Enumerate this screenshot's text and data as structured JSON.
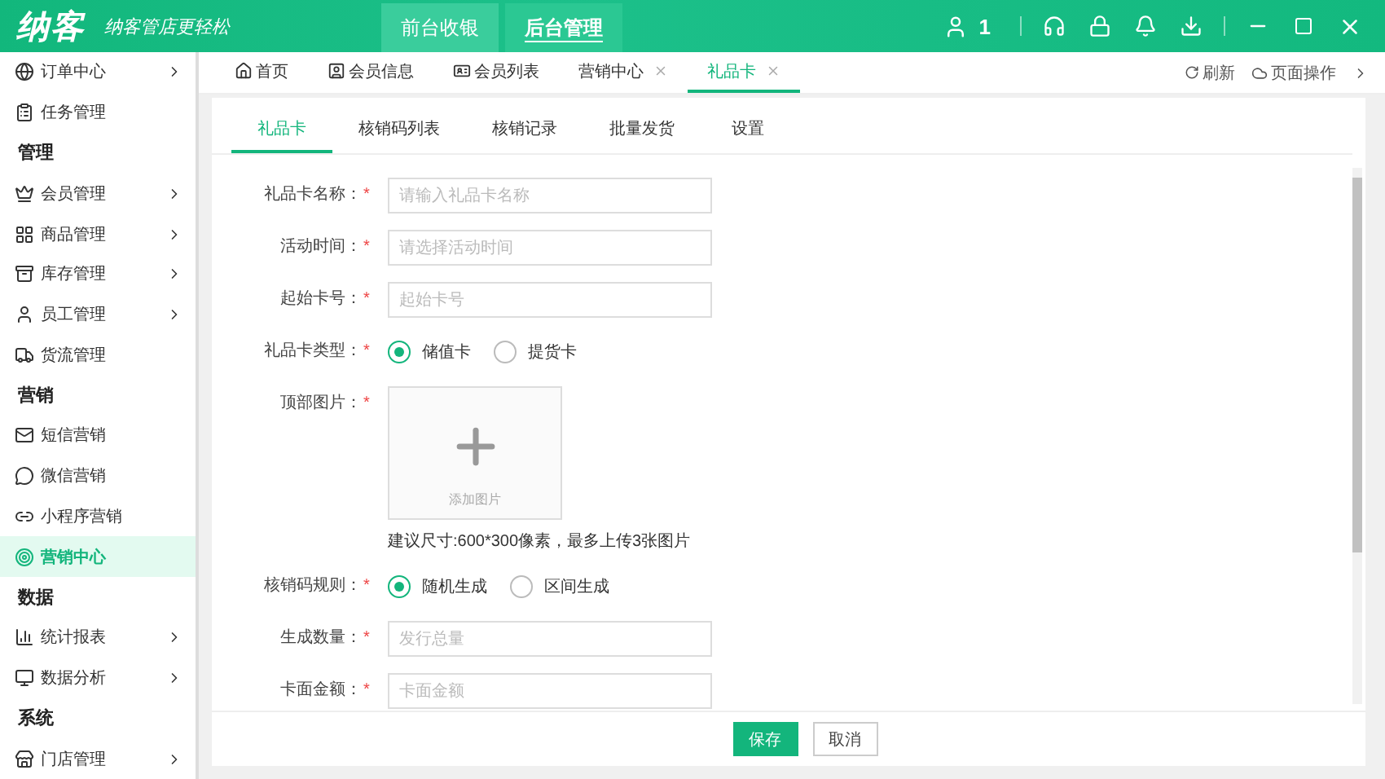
{
  "header": {
    "logo": "纳客",
    "slogan": "纳客管店更轻松",
    "modes": [
      {
        "label": "前台收银",
        "selected": false
      },
      {
        "label": "后台管理",
        "selected": true
      }
    ],
    "user_count": "1"
  },
  "sidebar": {
    "items": [
      {
        "kind": "item",
        "label": "订单中心",
        "arrow": true,
        "selected": false
      },
      {
        "kind": "item",
        "label": "任务管理",
        "arrow": false,
        "selected": false
      },
      {
        "kind": "heading",
        "label": "管理"
      },
      {
        "kind": "item",
        "label": "会员管理",
        "arrow": true,
        "selected": false
      },
      {
        "kind": "item",
        "label": "商品管理",
        "arrow": true,
        "selected": false
      },
      {
        "kind": "item",
        "label": "库存管理",
        "arrow": true,
        "selected": false
      },
      {
        "kind": "item",
        "label": "员工管理",
        "arrow": true,
        "selected": false
      },
      {
        "kind": "item",
        "label": "货流管理",
        "arrow": false,
        "selected": false
      },
      {
        "kind": "heading",
        "label": "营销"
      },
      {
        "kind": "item",
        "label": "短信营销",
        "arrow": false,
        "selected": false
      },
      {
        "kind": "item",
        "label": "微信营销",
        "arrow": false,
        "selected": false
      },
      {
        "kind": "item",
        "label": "小程序营销",
        "arrow": false,
        "selected": false
      },
      {
        "kind": "item",
        "label": "营销中心",
        "arrow": false,
        "selected": true
      },
      {
        "kind": "heading",
        "label": "数据"
      },
      {
        "kind": "item",
        "label": "统计报表",
        "arrow": true,
        "selected": false
      },
      {
        "kind": "item",
        "label": "数据分析",
        "arrow": true,
        "selected": false
      },
      {
        "kind": "heading",
        "label": "系统"
      },
      {
        "kind": "item",
        "label": "门店管理",
        "arrow": true,
        "selected": false
      }
    ]
  },
  "page_tabs": [
    {
      "label": "首页",
      "closable": false,
      "selected": false
    },
    {
      "label": "会员信息",
      "closable": false,
      "selected": false
    },
    {
      "label": "会员列表",
      "closable": false,
      "selected": false
    },
    {
      "label": "营销中心",
      "closable": true,
      "selected": false
    },
    {
      "label": "礼品卡",
      "closable": true,
      "selected": true
    }
  ],
  "page_actions": [
    "刷新",
    "页面操作"
  ],
  "sub_tabs": [
    {
      "label": "礼品卡",
      "selected": true
    },
    {
      "label": "核销码列表",
      "selected": false
    },
    {
      "label": "核销记录",
      "selected": false
    },
    {
      "label": "批量发货",
      "selected": false
    },
    {
      "label": "设置",
      "selected": false
    }
  ],
  "form": {
    "required_mark": "*",
    "fields": [
      {
        "kind": "input",
        "label": "礼品卡名称：",
        "placeholder": "请输入礼品卡名称"
      },
      {
        "kind": "input",
        "label": "活动时间：",
        "placeholder": "请选择活动时间"
      },
      {
        "kind": "input",
        "label": "起始卡号：",
        "placeholder": "起始卡号"
      },
      {
        "kind": "radio",
        "label": "礼品卡类型：",
        "options": [
          {
            "label": "储值卡",
            "selected": true
          },
          {
            "label": "提货卡",
            "selected": false
          }
        ]
      },
      {
        "kind": "upload",
        "label": "顶部图片：",
        "caption": "添加图片",
        "hint": "建议尺寸:600*300像素，最多上传3张图片"
      },
      {
        "kind": "radio",
        "label": "核销码规则：",
        "options": [
          {
            "label": "随机生成",
            "selected": true
          },
          {
            "label": "区间生成",
            "selected": false
          }
        ]
      },
      {
        "kind": "input",
        "label": "生成数量：",
        "placeholder": "发行总量"
      },
      {
        "kind": "input",
        "label": "卡面金额：",
        "placeholder": "卡面金额"
      }
    ]
  },
  "buttons": [
    {
      "kind": "primary",
      "label": "保存"
    },
    {
      "kind": "plain",
      "label": "取消"
    }
  ]
}
